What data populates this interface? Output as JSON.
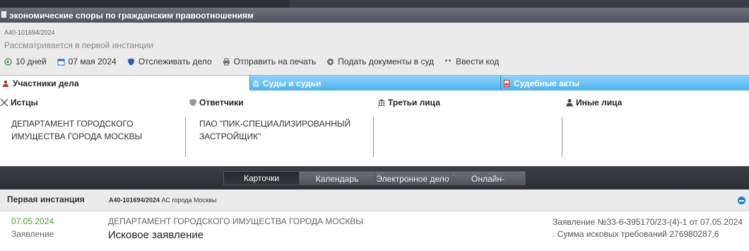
{
  "category": "экономические споры по гражданским правоотношениям",
  "case": {
    "number": "А40-101694/2024",
    "status": "Рассматривается в первой инстанции"
  },
  "actions": [
    {
      "icon": "back-arrow-icon",
      "label": "10 дней"
    },
    {
      "icon": "calendar-icon",
      "label": "07 мая 2024"
    },
    {
      "icon": "shield-icon",
      "label": "Отслеживать дело"
    },
    {
      "icon": "printer-icon",
      "label": "Отправить на печать"
    },
    {
      "icon": "plus-circle-icon",
      "label": "Подать документы в суд"
    },
    {
      "icon": "quote-icon",
      "label": "Ввести код"
    }
  ],
  "tabs": [
    {
      "label": "Участники дела",
      "icon": "person-icon",
      "active": true
    },
    {
      "label": "Суды и судьи",
      "icon": "building-icon",
      "active": false
    },
    {
      "label": "Судебные акты",
      "icon": "pdf-icon",
      "active": false
    }
  ],
  "parties": {
    "plaintiffs": {
      "title": "Истцы",
      "names": [
        "ДЕПАРТАМЕНТ ГОРОДСКОГО ИМУЩЕСТВА ГОРОДА МОСКВЫ"
      ]
    },
    "defendants": {
      "title": "Ответчики",
      "names": [
        "ПАО \"ПИК-СПЕЦИАЛИЗИРОВАННЫЙ ЗАСТРОЙЩИК\""
      ]
    },
    "third": {
      "title": "Третьи лица",
      "names": []
    },
    "other": {
      "title": "Иные лица",
      "names": []
    }
  },
  "view_tabs": [
    {
      "label": "Карточки",
      "active": true
    },
    {
      "label": "Календарь",
      "active": false
    },
    {
      "label": "Электронное дело",
      "active": false
    },
    {
      "label": "Онлайн-заседания",
      "active": false
    }
  ],
  "instance": {
    "title": "Первая инстанция",
    "case_number": "А40-101694/2024",
    "court": "АС города Москвы"
  },
  "event": {
    "date": "07.05.2024",
    "type": "Заявление",
    "party": "ДЕПАРТАМЕНТ ГОРОДСКОГО ИМУЩЕСТВА ГОРОДА МОСКВЫ",
    "document": "Исковое заявление",
    "note": "Заявление №33-6-395170/23-(4)-1 от 07.05.2024 . Сумма исковых требований 276980287,6"
  },
  "colors": {
    "accent_blue": "#4eb2ee",
    "date_green": "#4a9a2a",
    "dark_bar": "#2c2f34"
  }
}
